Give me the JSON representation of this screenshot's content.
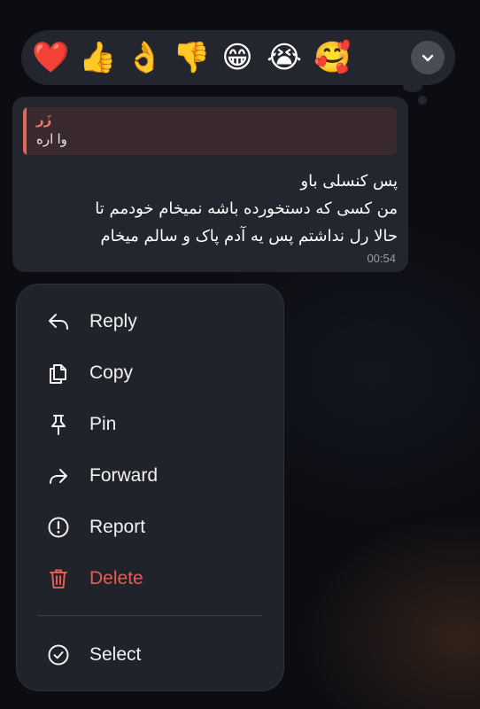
{
  "reactions": [
    {
      "name": "red-heart",
      "glyph": "❤️"
    },
    {
      "name": "thumbs-up",
      "glyph": "👍"
    },
    {
      "name": "ok-hand",
      "glyph": "👌"
    },
    {
      "name": "thumbs-down",
      "glyph": "👎"
    },
    {
      "name": "grinning-face",
      "glyph": "😁"
    },
    {
      "name": "crying-face",
      "glyph": "😭"
    },
    {
      "name": "smiling-face-with-hearts",
      "glyph": "🥰"
    }
  ],
  "message": {
    "reply": {
      "author": "زَر",
      "text": "وا اره"
    },
    "lines": [
      "پس کنسلی باو",
      "من کسی که دستخورده باشه نمیخام خودمم تا",
      "حالا رل نداشتم پس یه آدم پاک و سالم میخام"
    ],
    "time": "00:54"
  },
  "menu": {
    "items": [
      {
        "id": "reply",
        "label": "Reply",
        "icon": "reply-icon"
      },
      {
        "id": "copy",
        "label": "Copy",
        "icon": "copy-icon"
      },
      {
        "id": "pin",
        "label": "Pin",
        "icon": "pin-icon"
      },
      {
        "id": "forward",
        "label": "Forward",
        "icon": "forward-icon"
      },
      {
        "id": "report",
        "label": "Report",
        "icon": "report-icon"
      },
      {
        "id": "delete",
        "label": "Delete",
        "icon": "trash-icon"
      },
      {
        "id": "select",
        "label": "Select",
        "icon": "check-circle-icon"
      }
    ]
  },
  "colors": {
    "accent_danger": "#e55b55",
    "reply_accent": "#e0675b",
    "surface": "#23262e"
  }
}
